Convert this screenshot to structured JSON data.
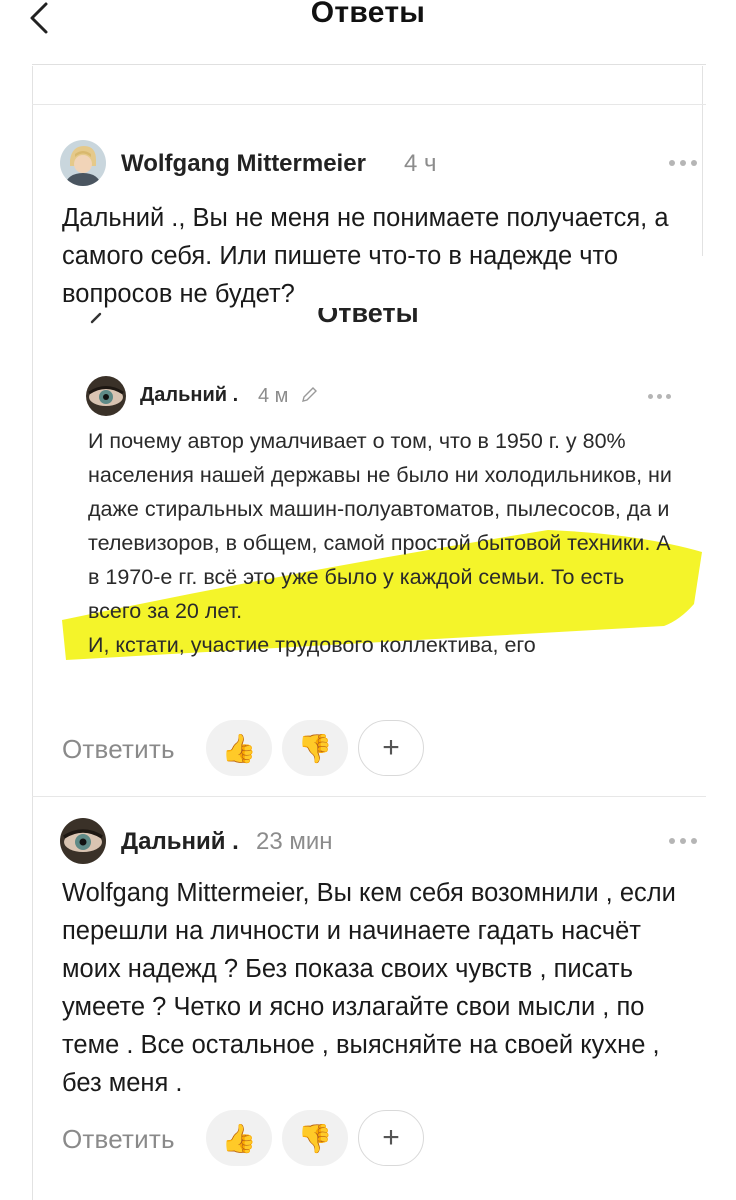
{
  "header": {
    "title": "Ответы"
  },
  "actions": {
    "reply_label": "Ответить"
  },
  "comments": [
    {
      "author": "Wolfgang Mittermeier",
      "time": "4 ч",
      "text": "Дальний ., Вы не меня не понимаете получается, а самого себя. Или пишете что-то в надежде что вопросов не будет?"
    },
    {
      "author": "Дальний .",
      "time": "23 мин",
      "text": "Wolfgang Mittermeier, Вы кем себя возомнили , если перешли на личности и начинаете  гадать насчёт моих надежд ? Без показа своих чувств , писать умеете ? Четко и ясно излагайте свои мысли , по теме . Все остальное , выясняйте на своей кухне , без меня ."
    }
  ],
  "embedded_screenshot": {
    "header_title": "Ответы",
    "author": "Дальний .",
    "time": "4 м",
    "text": "И почему автор умалчивает о том, что в 1950 г. у 80% населения нашей державы не было ни холодильников, ни даже стиральных машин-полуавтоматов, пылесосов, да и телевизоров, в общем, самой простой бытовой техники. А в 1970-е гг. всё это уже было у каждой семьи. То есть всего за 20 лет.",
    "text_2": "И, кстати, участие трудового коллектива, его",
    "highlight_color": "#f3f31a"
  },
  "colors": {
    "accent_thumb": "#f5b400",
    "muted": "#8a8a8a"
  }
}
